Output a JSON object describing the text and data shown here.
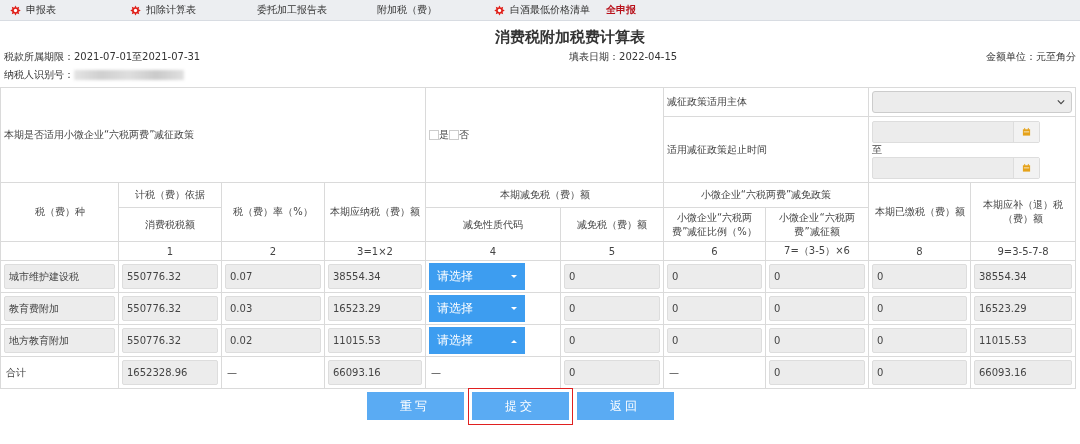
{
  "tabs": [
    {
      "label": "申报表",
      "kind": "tab",
      "marked": true
    },
    {
      "label": "扣除计算表",
      "kind": "tab",
      "marked": true
    },
    {
      "label": "委托加工报告表",
      "kind": "tab",
      "marked": false
    },
    {
      "label": "附加税（费）",
      "kind": "tab",
      "marked": false
    },
    {
      "label": "白酒最低价格清单",
      "kind": "tab",
      "marked": true
    },
    {
      "label": "全申报",
      "kind": "action",
      "marked": false
    }
  ],
  "title": "消费税附加税费计算表",
  "meta": {
    "period": "税款所属期限：2021-07-01至2021-07-31",
    "fill_date": "填表日期：2022-04-15",
    "unit": "金额单位：元至角分",
    "taxpayer_id_label": "纳税人识别号："
  },
  "policy": {
    "question": "本期是否适用小微企业“六税两费”减征政策",
    "options": [
      {
        "label": "是",
        "checked": false
      },
      {
        "label": "否",
        "checked": false
      }
    ],
    "subject_label": "减征政策适用主体",
    "period_label": "适用减征政策起止时间",
    "to": "至"
  },
  "header": {
    "tax_type": "税（费）种",
    "basis": "计税（费）依据",
    "basis_sub": "消费税税额",
    "rate": "税（费）率（%）",
    "payable": "本期应纳税（费）额",
    "relief": "本期减免税（费）额",
    "relief_code": "减免性质代码",
    "relief_amount": "减免税（费）额",
    "small": "小微企业“六税两费”减免政策",
    "small_ratio": "小微企业“六税两费”减征比例（%）",
    "small_amount": "小微企业“六税两费”减征额",
    "paid": "本期已缴税（费）额",
    "refund": "本期应补（退）税（费）额"
  },
  "col_numbers": [
    "1",
    "2",
    "3=1×2",
    "4",
    "5",
    "6",
    "7=（3-5）×6",
    "8",
    "9=3-5-7-8"
  ],
  "rows": [
    {
      "cells": [
        {
          "kind": "label",
          "text": "城市维护建设税"
        },
        {
          "kind": "field",
          "text": "550776.32"
        },
        {
          "kind": "field",
          "text": "0.07"
        },
        {
          "kind": "field",
          "text": "38554.34"
        },
        {
          "kind": "select",
          "text": "请选择",
          "expanded": false
        },
        {
          "kind": "field",
          "text": "0"
        },
        {
          "kind": "field",
          "text": "0"
        },
        {
          "kind": "field",
          "text": "0"
        },
        {
          "kind": "field",
          "text": "0"
        },
        {
          "kind": "field",
          "text": "38554.34"
        }
      ]
    },
    {
      "cells": [
        {
          "kind": "label",
          "text": "教育费附加"
        },
        {
          "kind": "field",
          "text": "550776.32"
        },
        {
          "kind": "field",
          "text": "0.03"
        },
        {
          "kind": "field",
          "text": "16523.29"
        },
        {
          "kind": "select",
          "text": "请选择",
          "expanded": false
        },
        {
          "kind": "field",
          "text": "0"
        },
        {
          "kind": "field",
          "text": "0"
        },
        {
          "kind": "field",
          "text": "0"
        },
        {
          "kind": "field",
          "text": "0"
        },
        {
          "kind": "field",
          "text": "16523.29"
        }
      ]
    },
    {
      "cells": [
        {
          "kind": "label",
          "text": "地方教育附加"
        },
        {
          "kind": "field",
          "text": "550776.32"
        },
        {
          "kind": "field",
          "text": "0.02"
        },
        {
          "kind": "field",
          "text": "11015.53"
        },
        {
          "kind": "select",
          "text": "请选择",
          "expanded": true
        },
        {
          "kind": "field",
          "text": "0"
        },
        {
          "kind": "field",
          "text": "0"
        },
        {
          "kind": "field",
          "text": "0"
        },
        {
          "kind": "field",
          "text": "0"
        },
        {
          "kind": "field",
          "text": "11015.53"
        }
      ]
    },
    {
      "cells": [
        {
          "kind": "text",
          "text": "合计"
        },
        {
          "kind": "field",
          "text": "1652328.96"
        },
        {
          "kind": "text",
          "text": "—"
        },
        {
          "kind": "field",
          "text": "66093.16"
        },
        {
          "kind": "text",
          "text": "—"
        },
        {
          "kind": "field",
          "text": "0"
        },
        {
          "kind": "text",
          "text": "—"
        },
        {
          "kind": "field",
          "text": "0"
        },
        {
          "kind": "field",
          "text": "0"
        },
        {
          "kind": "field",
          "text": "66093.16"
        }
      ]
    }
  ],
  "buttons": [
    {
      "label": "重写",
      "highlighted": false
    },
    {
      "label": "提交",
      "highlighted": true
    },
    {
      "label": "返回",
      "highlighted": false
    }
  ]
}
